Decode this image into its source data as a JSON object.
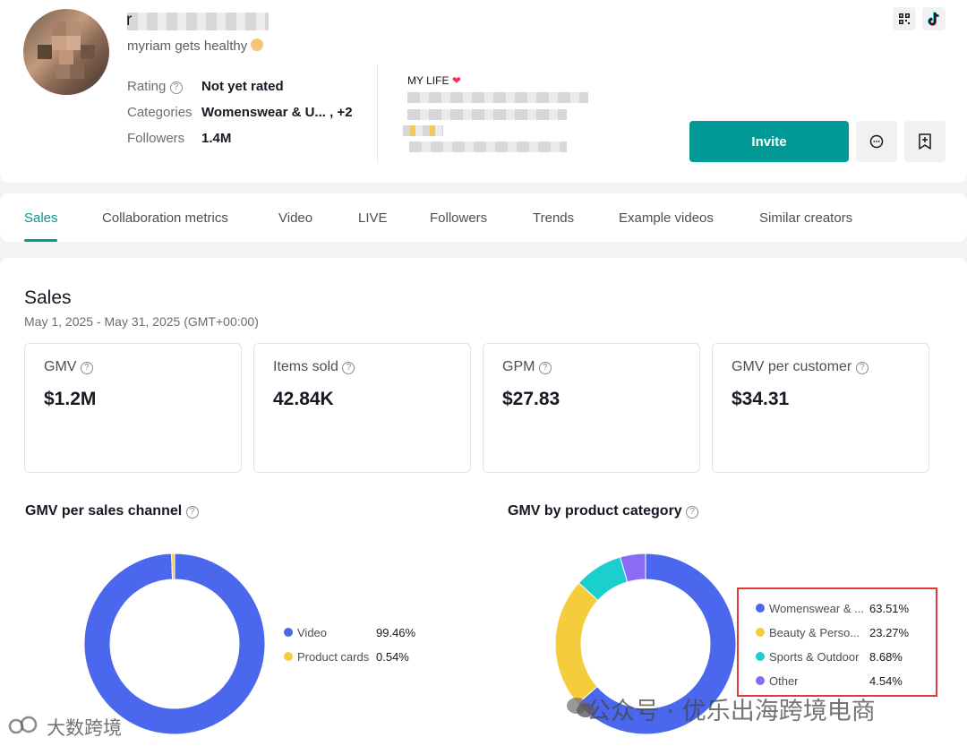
{
  "profile": {
    "name_initial": "r",
    "bio": "myriam gets healthy",
    "rating_label": "Rating",
    "rating_value": "Not yet rated",
    "categories_label": "Categories",
    "categories_value": "Womenswear & U... , +2",
    "followers_label": "Followers",
    "followers_value": "1.4M",
    "about_title": "MY LIFE",
    "invite_label": "Invite"
  },
  "tabs": [
    "Sales",
    "Collaboration metrics",
    "Video",
    "LIVE",
    "Followers",
    "Trends",
    "Example videos",
    "Similar creators"
  ],
  "sales": {
    "title": "Sales",
    "date_range": "May 1, 2025 - May 31, 2025 (GMT+00:00)",
    "metrics": [
      {
        "label": "GMV",
        "value": "$1.2M"
      },
      {
        "label": "Items sold",
        "value": "42.84K"
      },
      {
        "label": "GPM",
        "value": "$27.83"
      },
      {
        "label": "GMV per customer",
        "value": "$34.31"
      }
    ]
  },
  "charts": {
    "channel_title": "GMV per sales channel",
    "category_title": "GMV by product category"
  },
  "chart_data": [
    {
      "type": "pie",
      "title": "GMV per sales channel",
      "categories": [
        "Video",
        "Product cards"
      ],
      "values": [
        99.46,
        0.54
      ],
      "labels": [
        "99.46%",
        "0.54%"
      ],
      "colors": [
        "#4a67ee",
        "#f5cc3c"
      ],
      "legend": "right"
    },
    {
      "type": "pie",
      "title": "GMV by product category",
      "categories": [
        "Womenswear & ...",
        "Beauty & Perso...",
        "Sports & Outdoor",
        "Other"
      ],
      "values": [
        63.51,
        23.27,
        8.68,
        4.54
      ],
      "labels": [
        "63.51%",
        "23.27%",
        "8.68%",
        "4.54%"
      ],
      "colors": [
        "#4a67ee",
        "#f5cc3c",
        "#1ccfcf",
        "#8a6cf4"
      ],
      "legend": "right"
    }
  ],
  "watermark": {
    "left": "大数跨境",
    "right": "公众号 · 优乐出海跨境电商"
  },
  "colors": {
    "accent": "#009995",
    "highlight_box": "#e53935"
  }
}
